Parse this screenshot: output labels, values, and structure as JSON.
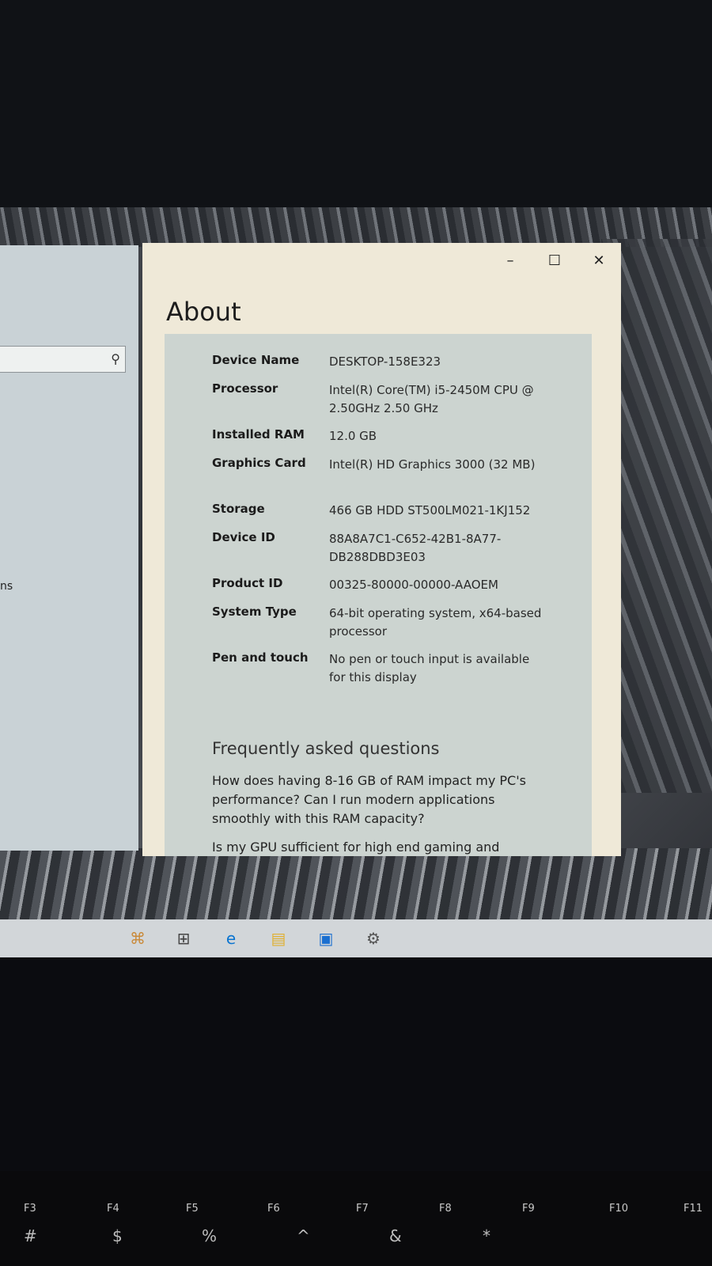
{
  "window": {
    "title": "About",
    "controls": {
      "minimize": "–",
      "maximize": "☐",
      "close": "✕"
    }
  },
  "specs": [
    {
      "label": "Device Name",
      "value": "DESKTOP-158E323"
    },
    {
      "label": "Processor",
      "value": "Intel(R) Core(TM) i5-2450M CPU @ 2.50GHz 2.50 GHz"
    },
    {
      "label": "Installed RAM",
      "value": "12.0 GB"
    },
    {
      "label": "Graphics Card",
      "value": "Intel(R) HD Graphics 3000 (32 MB)"
    },
    {
      "label": "Storage",
      "value": "466 GB HDD ST500LM021-1KJ152"
    },
    {
      "label": "Device ID",
      "value": "88A8A7C1-C652-42B1-8A77-DB288DBD3E03"
    },
    {
      "label": "Product ID",
      "value": "00325-80000-00000-AAOEM"
    },
    {
      "label": "System Type",
      "value": "64-bit operating system, x64-based processor"
    },
    {
      "label": "Pen and touch",
      "value": "No pen or touch input is available for this display"
    }
  ],
  "faq": {
    "heading": "Frequently asked questions",
    "questions": [
      "How does having 8-16 GB of RAM impact my PC's performance? Can I run modern applications smoothly with this RAM capacity?",
      "Is my GPU sufficient for high end gaming and"
    ]
  },
  "left_pane": {
    "fragment": "ns"
  },
  "keyboard": {
    "fkeys": [
      "F3",
      "F4",
      "F5",
      "F6",
      "F7",
      "F8",
      "F9",
      "F10",
      "F11"
    ],
    "symbols": [
      "#",
      "$",
      "%",
      "^",
      "&",
      "*"
    ]
  },
  "icons": {
    "search": "search-icon",
    "task_view": "task-view-icon",
    "edge": "edge-icon",
    "explorer": "file-explorer-icon",
    "store": "store-icon",
    "settings": "settings-icon"
  }
}
